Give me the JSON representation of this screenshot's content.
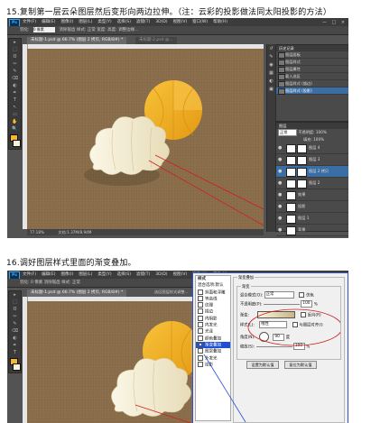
{
  "step15": {
    "caption": "15.复制第一层云朵图层然后变形向两边拉伸。（注：云彩的投影做法同太阳投影的方法）",
    "menu": [
      "文件(F)",
      "编辑(E)",
      "图像(I)",
      "图层(L)",
      "类型(Y)",
      "选择(S)",
      "滤镜(T)",
      "3D(D)",
      "视图(V)",
      "窗口(W)",
      "帮助(H)"
    ],
    "ps_logo": "Ps",
    "window_controls": "— □ ×",
    "options": {
      "label": "羽化:",
      "value": "0 像素",
      "extra": "消除锯齿  样式: 正常  宽度:  高度:  调整边缘..."
    },
    "doc_tabs": [
      "未标题-1.psd @ 66.7% (图层 2 拷贝, RGB/8#) *",
      "未标题-2.psd @..."
    ],
    "status": {
      "zoom": "77.18%",
      "doc": "文档:1.37M/8.94M"
    },
    "history_panel": {
      "title": "历史记录",
      "items": [
        "图层面板",
        "图层样式",
        "图层属性",
        "载入选区",
        "图层样式 (描边)",
        "图层样式 (投影)"
      ]
    },
    "layers_panel": {
      "title": "图层",
      "blend": "正常",
      "opacity_label": "不透明度:",
      "opacity": "100%",
      "fill_label": "填充:",
      "fill": "100%",
      "layers": [
        "图层 4",
        "图层 3",
        "图层 2 拷贝",
        "图层 2",
        "效果",
        "投影",
        "图层 1",
        "背景"
      ]
    },
    "tools": [
      "▸",
      "⬚",
      "ʘ",
      "✂",
      "✎",
      "⌫",
      "◐",
      "✒",
      "T",
      "↖",
      "▭",
      "✋",
      "🔍"
    ]
  },
  "step16": {
    "caption": "16.调好图层样式里面的渐变叠加。",
    "menu": [
      "文件(F)",
      "编辑(E)",
      "图像(I)",
      "图层(L)",
      "类型(Y)",
      "选择(S)",
      "滤镜(T)",
      "3D(D)",
      "视图(V)",
      "窗口(W)",
      "帮助(H)"
    ],
    "ps_logo": "Ps",
    "options_text": "羽化: 0 像素   消除锯齿   样式: 正常",
    "doc_tab": "未标题-1.psd @ 66.7% (图层 2 拷贝, RGB/8#) *",
    "right_hint": "选区图层样式调整...",
    "dialog": {
      "styles_header": "样式",
      "blend_options": "混合选项:默认",
      "styles": [
        "斜面和浮雕",
        "等高线",
        "纹理",
        "描边",
        "内阴影",
        "内发光",
        "光泽",
        "颜色叠加",
        "渐变叠加",
        "图案叠加",
        "外发光",
        "投影"
      ],
      "checked": [
        false,
        false,
        false,
        false,
        false,
        false,
        false,
        false,
        true,
        false,
        false,
        false
      ],
      "panel_title": "渐变叠加",
      "group_label": "渐变",
      "blend_mode_label": "混合模式(O):",
      "blend_mode": "正常",
      "dither_label": "仿色",
      "opacity_label": "不透明度(P):",
      "opacity": "100",
      "gradient_label": "渐变:",
      "reverse_label": "反向(R)",
      "style_label": "样式(L):",
      "style_value": "线性",
      "align_label": "与图层对齐(I)",
      "angle_label": "角度(N):",
      "angle": "90",
      "scale_label": "缩放(S):",
      "scale": "100",
      "default_btn": "设置为默认值",
      "reset_btn": "复位为默认值",
      "unit": "%",
      "degree": "度"
    }
  },
  "colors": {
    "canvas": "#8a6e4b",
    "sun": "#f3b22a",
    "accent_red": "#d01f1f",
    "selection": "#1f4fd6"
  }
}
